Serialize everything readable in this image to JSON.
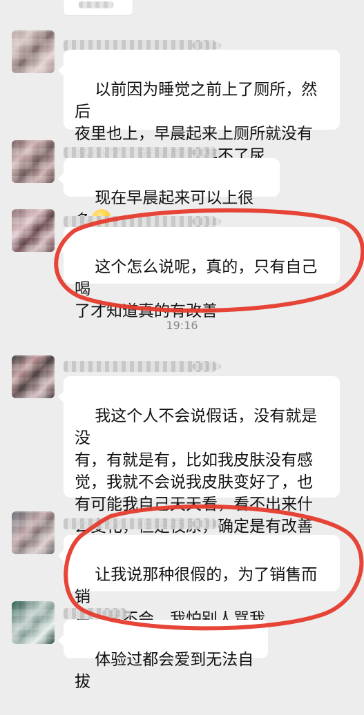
{
  "chat": {
    "messages": [
      {
        "text": "以前因为睡觉之前上了厕所，然后\n夜里也上，早晨起来上厕所就没有\n多少了，就是感觉存不了尿"
      },
      {
        "text": "现在早晨起来可以上很多"
      },
      {
        "text": "这个怎么说呢，真的，只有自己喝\n了才知道真的有改善"
      },
      {
        "text": "我这个人不会说假话，没有就是没\n有，有就是有，比如我皮肤没有感\n觉，我就不会说我皮肤变好了，也\n有可能我自己天天看，看不出来什\n么变化，但是夜尿，确定是有改善"
      },
      {
        "text": "让我说那种很假的，为了销售而销\n售，我不会，我怕别人骂我"
      },
      {
        "text": "体验过都会爱到无法自拔"
      }
    ],
    "time_divider": "19:16",
    "colors": {
      "background": "#ededed",
      "bubble": "#ffffff",
      "text": "#111111",
      "annotation_red": "#e53b2d"
    }
  }
}
